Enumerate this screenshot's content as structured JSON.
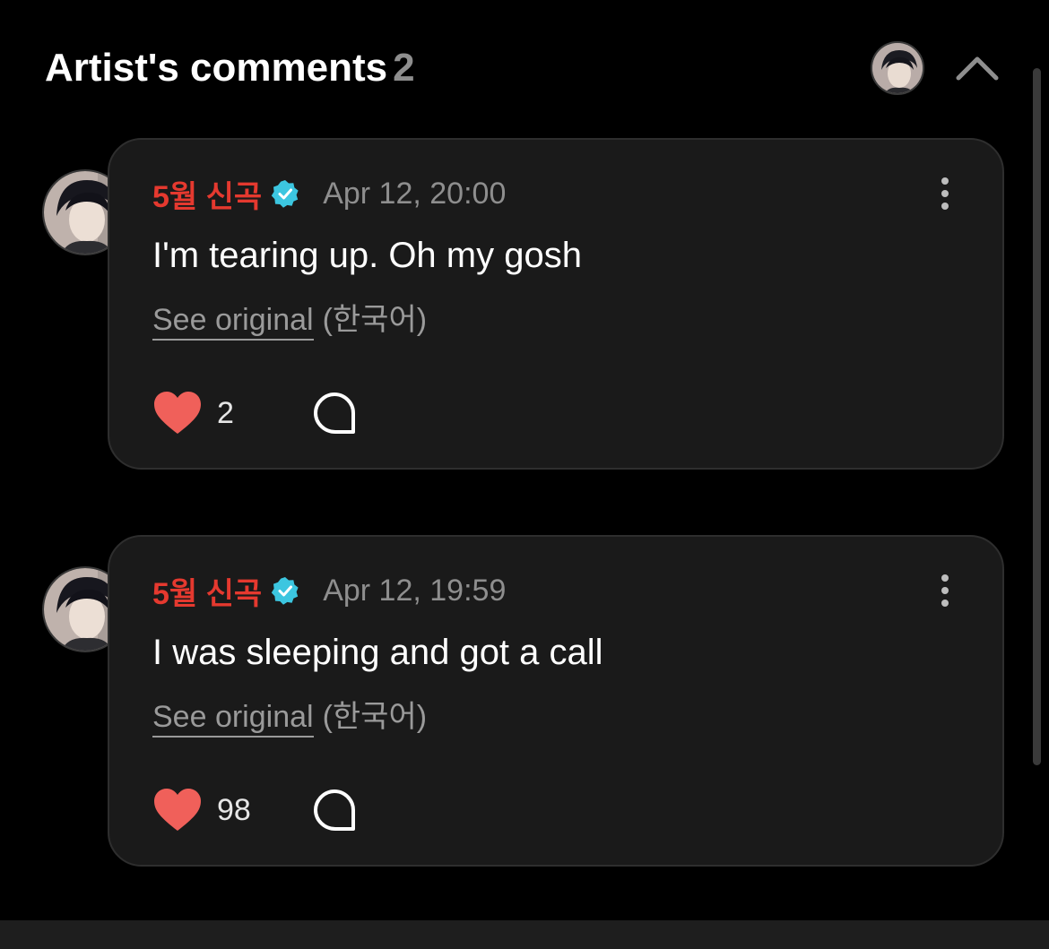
{
  "header": {
    "title": "Artist's comments",
    "count": "2"
  },
  "comments": [
    {
      "author": "5월 신곡",
      "timestamp": "Apr 12, 20:00",
      "text": "I'm tearing up. Oh my gosh",
      "see_original": "See original",
      "language": "(한국어)",
      "likes": "2"
    },
    {
      "author": "5월 신곡",
      "timestamp": "Apr 12, 19:59",
      "text": "I was sleeping and got a call",
      "see_original": "See original",
      "language": "(한국어)",
      "likes": "98"
    }
  ],
  "colors": {
    "background": "#000000",
    "card": "#1a1a1a",
    "author": "#e5392f",
    "verified": "#3cc6e0",
    "heart": "#f0605a",
    "muted": "#8e8e8e"
  },
  "icons": {
    "collapse": "chevron-up-icon",
    "verified": "verified-badge-icon",
    "more": "more-vertical-icon",
    "like": "heart-icon",
    "reply": "comment-bubble-icon"
  }
}
